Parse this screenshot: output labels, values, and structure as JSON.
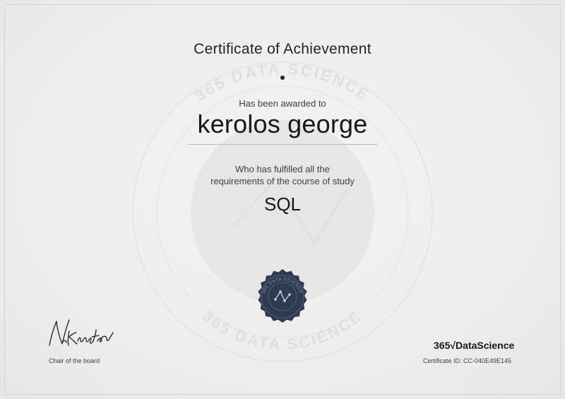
{
  "certificate": {
    "title": "Certificate of Achievement",
    "awarded_label": "Has been awarded to",
    "recipient_name": "kerolos george",
    "requirements_line1": "Who has fulfilled all the",
    "requirements_line2": "requirements of the course of study",
    "course_name": "SQL"
  },
  "watermark": {
    "text": "365 DATA SCIENCE"
  },
  "seal": {
    "text": "365 DATA SCIENCE",
    "icon": "data-graph-icon"
  },
  "signature": {
    "text": "N.Krastev",
    "role_label": "Chair of the board"
  },
  "issuer": {
    "brand": "365√DataScience",
    "certificate_id": "Certificate ID: CC-040E49E145"
  },
  "colors": {
    "background": "#ecedeb",
    "text": "#1c1f2a",
    "seal": "#2f3b52"
  }
}
